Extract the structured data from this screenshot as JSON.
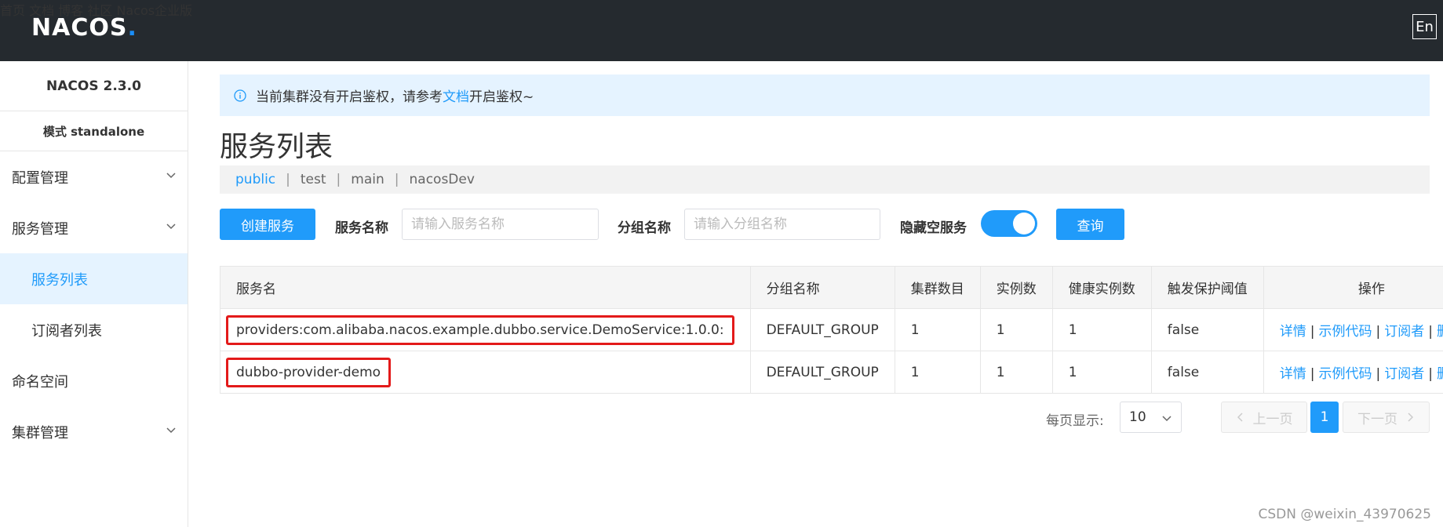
{
  "header": {
    "logo_text": "NACOS",
    "logo_dot": ".",
    "nav": [
      "首页",
      "文档",
      "博客",
      "社区",
      "Nacos企业版"
    ],
    "lang_button": "En"
  },
  "sidebar": {
    "version": "NACOS 2.3.0",
    "mode": "模式 standalone",
    "items": [
      {
        "label": "配置管理",
        "expandable": true
      },
      {
        "label": "服务管理",
        "expandable": true
      },
      {
        "label": "服务列表",
        "active": true
      },
      {
        "label": "订阅者列表"
      },
      {
        "label": "命名空间"
      },
      {
        "label": "集群管理",
        "expandable": true
      }
    ]
  },
  "notice": {
    "text_before": "当前集群没有开启鉴权，请参考",
    "link": "文档",
    "text_after": "开启鉴权~"
  },
  "page_title": "服务列表",
  "namespaces": [
    {
      "label": "public",
      "active": true
    },
    {
      "label": "test"
    },
    {
      "label": "main"
    },
    {
      "label": "nacosDev"
    }
  ],
  "toolbar": {
    "create_button": "创建服务",
    "service_name_label": "服务名称",
    "service_name_placeholder": "请输入服务名称",
    "group_name_label": "分组名称",
    "group_name_placeholder": "请输入分组名称",
    "hide_empty_label": "隐藏空服务",
    "hide_empty_on": true,
    "query_button": "查询"
  },
  "table": {
    "headers": [
      "服务名",
      "分组名称",
      "集群数目",
      "实例数",
      "健康实例数",
      "触发保护阈值",
      "操作"
    ],
    "rows": [
      {
        "service": "providers:com.alibaba.nacos.example.dubbo.service.DemoService:1.0.0:",
        "group": "DEFAULT_GROUP",
        "clusters": "1",
        "instances": "1",
        "healthy": "1",
        "threshold": "false"
      },
      {
        "service": "dubbo-provider-demo",
        "group": "DEFAULT_GROUP",
        "clusters": "1",
        "instances": "1",
        "healthy": "1",
        "threshold": "false"
      }
    ],
    "ops": [
      "详情",
      "示例代码",
      "订阅者",
      "删除"
    ],
    "op_separator": "|"
  },
  "pagination": {
    "per_page_label": "每页显示:",
    "page_size": "10",
    "prev": "上一页",
    "current_page": "1",
    "next": "下一页"
  },
  "watermark": "CSDN @weixin_43970625",
  "colors": {
    "primary": "#209bfa",
    "header_bg": "#252a2f",
    "highlight_border": "#e31a1a"
  }
}
